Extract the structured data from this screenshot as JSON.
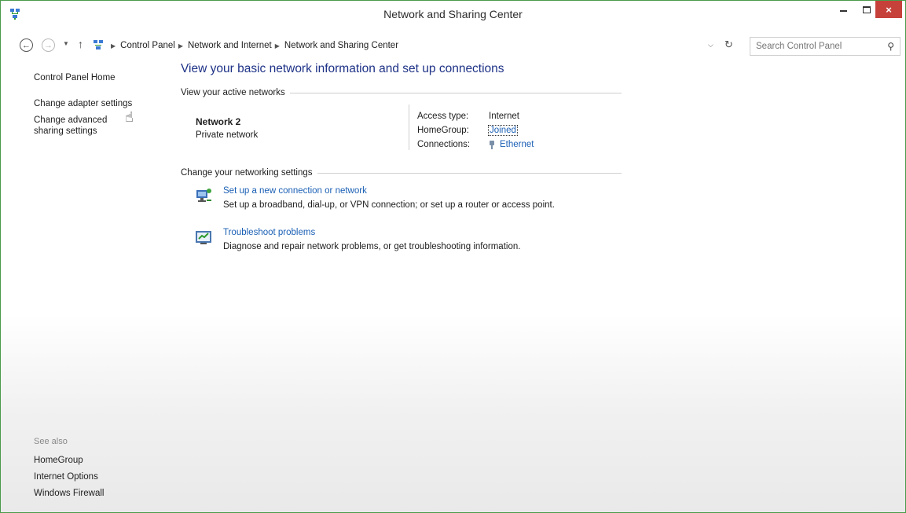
{
  "window": {
    "title": "Network and Sharing Center",
    "icon": "network-sharing-icon",
    "controls": {
      "minimize": "minimize-icon",
      "maximize": "maximize-icon",
      "close_label": "×"
    }
  },
  "navigation": {
    "back_icon": "back-arrow-icon",
    "forward_icon": "forward-arrow-icon",
    "up_icon": "up-arrow-icon",
    "breadcrumbs": [
      "Control Panel",
      "Network and Internet",
      "Network and Sharing Center"
    ],
    "search": {
      "placeholder": "Search Control Panel",
      "value": ""
    }
  },
  "sidebar": {
    "items": [
      {
        "label": "Control Panel Home"
      },
      {
        "label": "Change adapter settings"
      },
      {
        "label": "Change advanced sharing settings"
      }
    ],
    "see_also": {
      "title": "See also",
      "links": [
        "HomeGroup",
        "Internet Options",
        "Windows Firewall"
      ]
    }
  },
  "main": {
    "title": "View your basic network information and set up connections",
    "active_networks": {
      "label": "View your active networks",
      "network_name": "Network  2",
      "network_category": "Private network",
      "access_type_label": "Access type:",
      "access_type_value": "Internet",
      "homegroup_label": "HomeGroup:",
      "homegroup_value": "Joined",
      "connections_label": "Connections:",
      "connections_value": "Ethernet"
    },
    "change_settings": {
      "label": "Change your networking settings",
      "tasks": [
        {
          "link": "Set up a new connection or network",
          "description": "Set up a broadband, dial-up, or VPN connection; or set up a router or access point."
        },
        {
          "link": "Troubleshoot problems",
          "description": "Diagnose and repair network problems, or get troubleshooting information."
        }
      ]
    }
  },
  "colors": {
    "title_text": "#1e3287",
    "link": "#1a5fb4",
    "close_button": "#c7413b",
    "window_border": "#4a9a4a"
  }
}
